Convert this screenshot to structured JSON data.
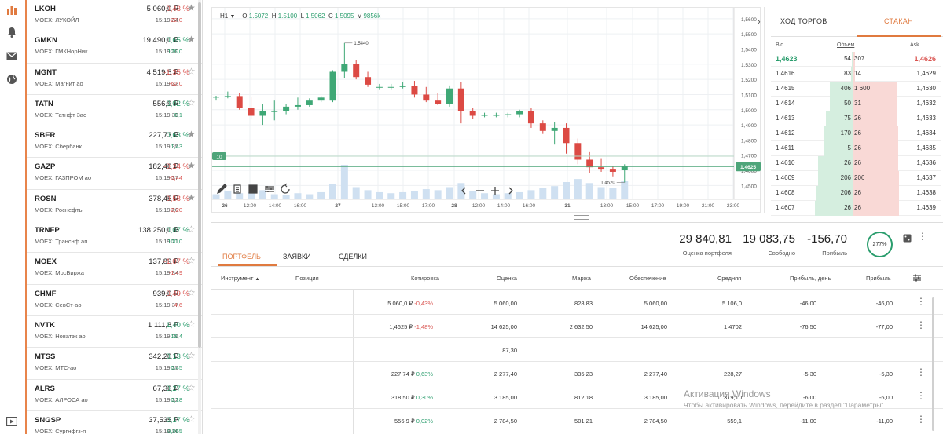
{
  "rail": {
    "icons": [
      "chart-icon",
      "bell-icon",
      "mail-icon",
      "globe-icon",
      "video-icon"
    ]
  },
  "watchlist": [
    {
      "ticker": "LKOH",
      "price": "5 060,0 ₽",
      "change": "-0,43 %",
      "sub": "MOEX: ЛУКОЙЛ",
      "time": "15:19:34",
      "abs": "-22,0",
      "dir": "neg",
      "star": "★"
    },
    {
      "ticker": "GMKN",
      "price": "19 490,0 ₽",
      "change": "0,65 %",
      "sub": "MOEX: ГМКНорНик",
      "time": "15:19:20",
      "abs": "126,0",
      "dir": "pos",
      "star": "★"
    },
    {
      "ticker": "MGNT",
      "price": "4 519,5 ₽",
      "change": "-1,35 %",
      "sub": "MOEX: Магнит ао",
      "time": "15:19:32",
      "abs": "-62,0",
      "dir": "neg",
      "star": "☆"
    },
    {
      "ticker": "TATN",
      "price": "556,9 ₽",
      "change": "0,02 %",
      "sub": "MOEX: Татнфт 3ао",
      "time": "15:19:30",
      "abs": "0,1",
      "dir": "pos",
      "star": "☆"
    },
    {
      "ticker": "SBER",
      "price": "227,73 ₽",
      "change": "0,63 %",
      "sub": "MOEX: Сбербанк",
      "time": "15:19:35",
      "abs": "1,43",
      "dir": "pos",
      "star": "★"
    },
    {
      "ticker": "GAZP",
      "price": "182,46 ₽",
      "change": "-0,24 %",
      "sub": "MOEX: ГАЗПРОМ ао",
      "time": "15:19:37",
      "abs": "-0,44",
      "dir": "neg",
      "star": "★"
    },
    {
      "ticker": "ROSN",
      "price": "378,45 ₽",
      "change": "-0,58 %",
      "sub": "MOEX: Роснефть",
      "time": "15:19:20",
      "abs": "-2,20",
      "dir": "neg",
      "star": "★"
    },
    {
      "ticker": "TRNFP",
      "price": "138 250,0 ₽",
      "change": "0,07 %",
      "sub": "MOEX: Транснф ап",
      "time": "15:19:21",
      "abs": "100,0",
      "dir": "pos",
      "star": "☆"
    },
    {
      "ticker": "MOEX",
      "price": "137,89 ₽",
      "change": "-1,07 %",
      "sub": "MOEX: МосБиржа",
      "time": "15:19:34",
      "abs": "-1,49",
      "dir": "neg",
      "star": "☆"
    },
    {
      "ticker": "CHMF",
      "price": "939,0 ₽",
      "change": "-0,49 %",
      "sub": "MOEX: СевСт-ао",
      "time": "15:19:37",
      "abs": "-4,6",
      "dir": "neg",
      "star": "☆"
    },
    {
      "ticker": "NVTK",
      "price": "1 111,8 ₽",
      "change": "1,40 %",
      "sub": "MOEX: Новатэк ао",
      "time": "15:19:26",
      "abs": "15,4",
      "dir": "pos",
      "star": "☆"
    },
    {
      "ticker": "MTSS",
      "price": "342,20 ₽",
      "change": "0,13 %",
      "sub": "MOEX: МТС-ао",
      "time": "15:19:35",
      "abs": "0,45",
      "dir": "pos",
      "star": "☆"
    },
    {
      "ticker": "ALRS",
      "price": "67,36 ₽",
      "change": "0,27 %",
      "sub": "MOEX: АЛРОСА ао",
      "time": "15:19:32",
      "abs": "0,18",
      "dir": "pos",
      "star": "☆"
    },
    {
      "ticker": "SNGSP",
      "price": "37,535 ₽",
      "change": "0,17 %",
      "sub": "MOEX: Сургнфгз-п",
      "time": "15:19:36",
      "abs": "0,065",
      "dir": "pos",
      "star": "☆"
    }
  ],
  "chart": {
    "timeframe": "H1",
    "legend": {
      "o_label": "O",
      "o": "1.5072",
      "h_label": "H",
      "h": "1.5100",
      "l_label": "L",
      "l": "1.5062",
      "c_label": "C",
      "c": "1.5095",
      "v_label": "V",
      "v": "9856k"
    },
    "y_ticks": [
      "1,5600",
      "1,5500",
      "1,5400",
      "1,5300",
      "1,5200",
      "1,5100",
      "1,5000",
      "1,4900",
      "1,4800",
      "1,4700",
      "1,4600",
      "1,4500"
    ],
    "x_ticks": [
      "26",
      "12:00",
      "14:00",
      "16:00",
      "27",
      "13:00",
      "15:00",
      "17:00",
      "28",
      "12:00",
      "14:00",
      "16:00",
      "31",
      "13:00",
      "15:00",
      "17:00",
      "19:00",
      "21:00",
      "23:00"
    ],
    "x_bold": [
      true,
      false,
      false,
      false,
      true,
      false,
      false,
      false,
      true,
      false,
      false,
      false,
      true,
      false,
      false,
      false,
      false,
      false,
      false
    ],
    "high_label": "1.5440",
    "low_label": "1.4520",
    "left_tag": "10",
    "price_tag": "1.4625",
    "colors": {
      "up": "#3fa876",
      "down": "#dc4a44",
      "volume": "#cfe0f1",
      "price_line": "#4ea57a"
    },
    "ylim": [
      1.445,
      1.562
    ],
    "candles": [
      [
        1.5082,
        1.5092,
        1.506,
        1.5085
      ],
      [
        1.5088,
        1.512,
        1.5075,
        1.509
      ],
      [
        1.509,
        1.511,
        1.5,
        1.501
      ],
      [
        1.501,
        1.5085,
        1.494,
        1.496
      ],
      [
        1.496,
        1.504,
        1.49,
        1.499
      ],
      [
        1.499,
        1.506,
        1.493,
        1.499
      ],
      [
        1.499,
        1.504,
        1.497,
        1.502
      ],
      [
        1.502,
        1.508,
        1.5,
        1.503
      ],
      [
        1.503,
        1.5075,
        1.502,
        1.506
      ],
      [
        1.506,
        1.509,
        1.505,
        1.508
      ],
      [
        1.506,
        1.526,
        1.505,
        1.525
      ],
      [
        1.525,
        1.544,
        1.521,
        1.53
      ],
      [
        1.53,
        1.533,
        1.52,
        1.5215
      ],
      [
        1.5215,
        1.525,
        1.515,
        1.5165
      ],
      [
        1.515,
        1.517,
        1.513,
        1.515
      ],
      [
        1.515,
        1.517,
        1.513,
        1.515
      ],
      [
        1.515,
        1.518,
        1.514,
        1.5155
      ],
      [
        1.5155,
        1.519,
        1.508,
        1.51
      ],
      [
        1.51,
        1.515,
        1.505,
        1.506
      ],
      [
        1.506,
        1.511,
        1.503,
        1.504
      ],
      [
        1.504,
        1.516,
        1.502,
        1.514
      ],
      [
        1.514,
        1.518,
        1.491,
        1.499
      ],
      [
        1.499,
        1.501,
        1.494,
        1.496
      ],
      [
        1.496,
        1.498,
        1.495,
        1.4965
      ],
      [
        1.4965,
        1.498,
        1.495,
        1.4965
      ],
      [
        1.4965,
        1.498,
        1.495,
        1.497
      ],
      [
        1.497,
        1.5,
        1.495,
        1.499
      ],
      [
        1.499,
        1.501,
        1.488,
        1.491
      ],
      [
        1.491,
        1.493,
        1.484,
        1.486
      ],
      [
        1.486,
        1.492,
        1.477,
        1.488
      ],
      [
        1.488,
        1.491,
        1.471,
        1.478
      ],
      [
        1.478,
        1.481,
        1.464,
        1.467
      ],
      [
        1.467,
        1.472,
        1.458,
        1.462
      ],
      [
        1.462,
        1.468,
        1.459,
        1.461
      ],
      [
        1.461,
        1.463,
        1.456,
        1.459
      ],
      [
        1.46,
        1.464,
        1.452,
        1.4625
      ]
    ],
    "volumes": [
      5,
      8,
      6,
      7,
      9,
      5,
      4,
      6,
      5,
      7,
      15,
      34,
      12,
      9,
      7,
      6,
      7,
      8,
      10,
      9,
      12,
      16,
      8,
      6,
      5,
      6,
      7,
      9,
      11,
      13,
      17,
      20,
      16,
      12,
      11,
      18
    ],
    "toolbar_icons": [
      "pencil-icon",
      "notes-icon",
      "add-chart-icon",
      "settings-sliders-icon",
      "refresh-icon"
    ],
    "nav_icons": [
      "chevron-left-icon",
      "minus-icon",
      "plus-icon",
      "chevron-right-icon"
    ]
  },
  "orderbook": {
    "tab_trades": "ХОД ТОРГОВ",
    "tab_book": "СТАКАН",
    "head_bid": "Bid",
    "head_volume": "Объем",
    "head_ask": "Ask",
    "rows": [
      {
        "bid": "1,4623",
        "bid_vol": "54",
        "ask_vol": "307",
        "ask": "1,4626",
        "bidbar": 0.02,
        "askbar": 0.05,
        "highlight": true
      },
      {
        "bid": "1,4616",
        "bid_vol": "83",
        "ask_vol": "14",
        "ask": "1,4629",
        "bidbar": 0.03,
        "askbar": 0.05
      },
      {
        "bid": "1,4615",
        "bid_vol": "406",
        "ask_vol": "1 600",
        "ask": "1,4630",
        "bidbar": 0.48,
        "askbar": 0.94
      },
      {
        "bid": "1,4614",
        "bid_vol": "50",
        "ask_vol": "31",
        "ask": "1,4632",
        "bidbar": 0.48,
        "askbar": 0.94
      },
      {
        "bid": "1,4613",
        "bid_vol": "75",
        "ask_vol": "26",
        "ask": "1,4633",
        "bidbar": 0.56,
        "askbar": 0.94
      },
      {
        "bid": "1,4612",
        "bid_vol": "170",
        "ask_vol": "26",
        "ask": "1,4634",
        "bidbar": 0.6,
        "askbar": 0.96
      },
      {
        "bid": "1,4611",
        "bid_vol": "5",
        "ask_vol": "26",
        "ask": "1,4635",
        "bidbar": 0.62,
        "askbar": 0.96
      },
      {
        "bid": "1,4610",
        "bid_vol": "26",
        "ask_vol": "26",
        "ask": "1,4636",
        "bidbar": 0.74,
        "askbar": 0.97
      },
      {
        "bid": "1,4609",
        "bid_vol": "206",
        "ask_vol": "206",
        "ask": "1,4637",
        "bidbar": 0.74,
        "askbar": 0.98
      },
      {
        "bid": "1,4608",
        "bid_vol": "206",
        "ask_vol": "26",
        "ask": "1,4638",
        "bidbar": 0.78,
        "askbar": 0.98
      },
      {
        "bid": "1,4607",
        "bid_vol": "26",
        "ask_vol": "26",
        "ask": "1,4639",
        "bidbar": 0.8,
        "askbar": 0.99
      }
    ]
  },
  "portfolio": {
    "summary": [
      {
        "value": "29 840,81",
        "label": "Оценка портфеля",
        "dir": ""
      },
      {
        "value": "19 083,75",
        "label": "Свободно",
        "dir": ""
      },
      {
        "value": "-156,70",
        "label": "Прибыль",
        "dir": "neg"
      }
    ],
    "gauge": "277%",
    "tabs": [
      "ПОРТФЕЛЬ",
      "ЗАЯВКИ",
      "СДЕЛКИ"
    ],
    "headers": [
      "Инструмент",
      "Позиция",
      "Котировка",
      "Оценка",
      "Маржа",
      "Обеспечение",
      "Средняя",
      "Прибыль, день",
      "Прибыль"
    ],
    "sort_icon": "▲",
    "rows": [
      {
        "quote": "5 060,0 ₽",
        "qchg": "-0,43%",
        "qdir": "neg",
        "value": "5 060,00",
        "margin": "828,83",
        "collateral": "5 060,00",
        "avg": "5 106,0",
        "pday": "-46,00",
        "profit": "-46,00",
        "menu": true
      },
      {
        "quote": "1,4625 ₽",
        "qchg": "-1,48%",
        "qdir": "neg",
        "value": "14 625,00",
        "margin": "2 632,50",
        "collateral": "14 625,00",
        "avg": "1,4702",
        "pday": "-76,50",
        "profit": "-77,00",
        "menu": true
      },
      {
        "quote": "",
        "qchg": "",
        "qdir": "",
        "value": "87,30",
        "margin": "",
        "collateral": "",
        "avg": "",
        "pday": "",
        "profit": "",
        "menu": false
      },
      {
        "quote": "227,74 ₽",
        "qchg": "0,63%",
        "qdir": "pos",
        "value": "2 277,40",
        "margin": "335,23",
        "collateral": "2 277,40",
        "avg": "228,27",
        "pday": "-5,30",
        "profit": "-5,30",
        "menu": true
      },
      {
        "quote": "318,50 ₽",
        "qchg": "0,30%",
        "qdir": "pos",
        "value": "3 185,00",
        "margin": "812,18",
        "collateral": "3 185,00",
        "avg": "319,10",
        "pday": "-6,00",
        "profit": "-6,00",
        "menu": true
      },
      {
        "quote": "556,9 ₽",
        "qchg": "0,02%",
        "qdir": "pos",
        "value": "2 784,50",
        "margin": "501,21",
        "collateral": "2 784,50",
        "avg": "559,1",
        "pday": "-11,00",
        "profit": "-11,00",
        "menu": true
      }
    ]
  },
  "watermark": {
    "title": "Активация Windows",
    "text": "Чтобы активировать Windows, перейдите в раздел \"Параметры\"."
  }
}
